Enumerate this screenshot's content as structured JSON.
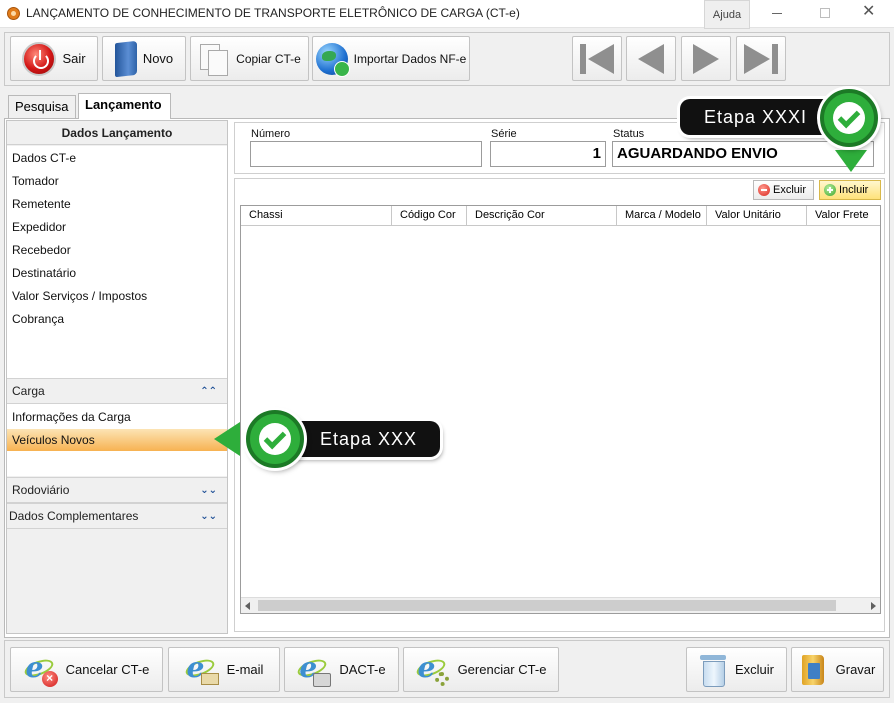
{
  "window": {
    "title": "LANÇAMENTO DE CONHECIMENTO DE TRANSPORTE ELETRÔNICO DE CARGA (CT-e)",
    "help_label": "Ajuda",
    "close_glyph": "✕"
  },
  "toolbar": {
    "sair_label": "Sair",
    "novo_label": "Novo",
    "copiar_label": "Copiar CT-e",
    "importar_label": "Importar Dados NF-e"
  },
  "tabs": [
    {
      "label": "Pesquisa",
      "active": false
    },
    {
      "label": "Lançamento",
      "active": true
    }
  ],
  "left_panel": {
    "header": "Dados Lançamento",
    "items": [
      "Dados CT-e",
      "Tomador",
      "Remetente",
      "Expedidor",
      "Recebedor",
      "Destinatário",
      "Valor Serviços / Impostos",
      "Cobrança"
    ],
    "groups": [
      {
        "label": "Carga",
        "chevron": "⌃⌃",
        "expanded": true,
        "items": [
          "Informações da Carga",
          "Veículos Novos"
        ],
        "selected": "Veículos Novos"
      },
      {
        "label": "Rodoviário",
        "chevron": "⌄⌄",
        "expanded": false
      },
      {
        "label": "Dados Complementares",
        "chevron": "⌄⌄",
        "expanded": false
      }
    ]
  },
  "header_fields": {
    "numero": {
      "label": "Número",
      "value": ""
    },
    "serie": {
      "label": "Série",
      "value": "1"
    },
    "status": {
      "label": "Status",
      "value": "AGUARDANDO ENVIO"
    }
  },
  "grid": {
    "excluir_label": "Excluir",
    "incluir_label": "Incluir",
    "columns": [
      "Chassi",
      "Código Cor",
      "Descrição Cor",
      "Marca / Modelo",
      "Valor Unitário",
      "Valor Frete"
    ],
    "rows": []
  },
  "bottom": {
    "cancelar_label": "Cancelar CT-e",
    "email_label": "E-mail",
    "dacte_label": "DACT-e",
    "gerenciar_label": "Gerenciar CT-e",
    "excluir_label": "Excluir",
    "gravar_label": "Gravar"
  },
  "callouts": {
    "step_a": "Etapa XXX",
    "step_b": "Etapa XXXI"
  },
  "colors": {
    "accent_green": "#2eae3b",
    "selected_item": "#f7b252",
    "chevron_blue": "#1e4f96"
  }
}
